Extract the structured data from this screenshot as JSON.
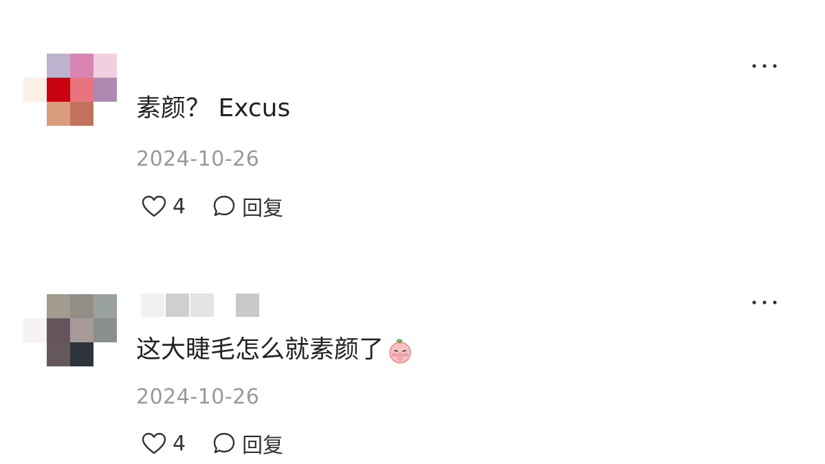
{
  "comments": [
    {
      "text": "素颜？ Excus",
      "date": "2024-10-26",
      "likes": "4",
      "reply_label": "回复",
      "avatar_colors": [
        [
          "",
          "#bcb3cf",
          "#da84b4",
          "#f1cfe1"
        ],
        [
          "#fbefe7",
          "#c8000f",
          "#e8737d",
          "#ae8ab3"
        ],
        [
          "",
          "#d99c7c",
          "#c2725f",
          ""
        ]
      ]
    },
    {
      "text": "这大睫毛怎么就素颜了",
      "emoji": "peach-face-emoji",
      "date": "2024-10-26",
      "likes": "4",
      "reply_label": "回复",
      "avatar_colors": [
        [
          "",
          "#a39a90",
          "#928e86",
          "#9aa2a0"
        ],
        [
          "#f6f2f5",
          "#67545d",
          "#a89a99",
          "#8b8f8c"
        ],
        [
          "",
          "#66585a",
          "#2d333b",
          ""
        ]
      ],
      "username_blocks": [
        "#f1f1f1",
        "#cfcfcf",
        "#e4e4e4",
        "#c9c9c9"
      ]
    }
  ],
  "icons": {
    "more": "more-horizontal-icon",
    "like": "heart-outline-icon",
    "reply": "chat-bubble-icon"
  }
}
